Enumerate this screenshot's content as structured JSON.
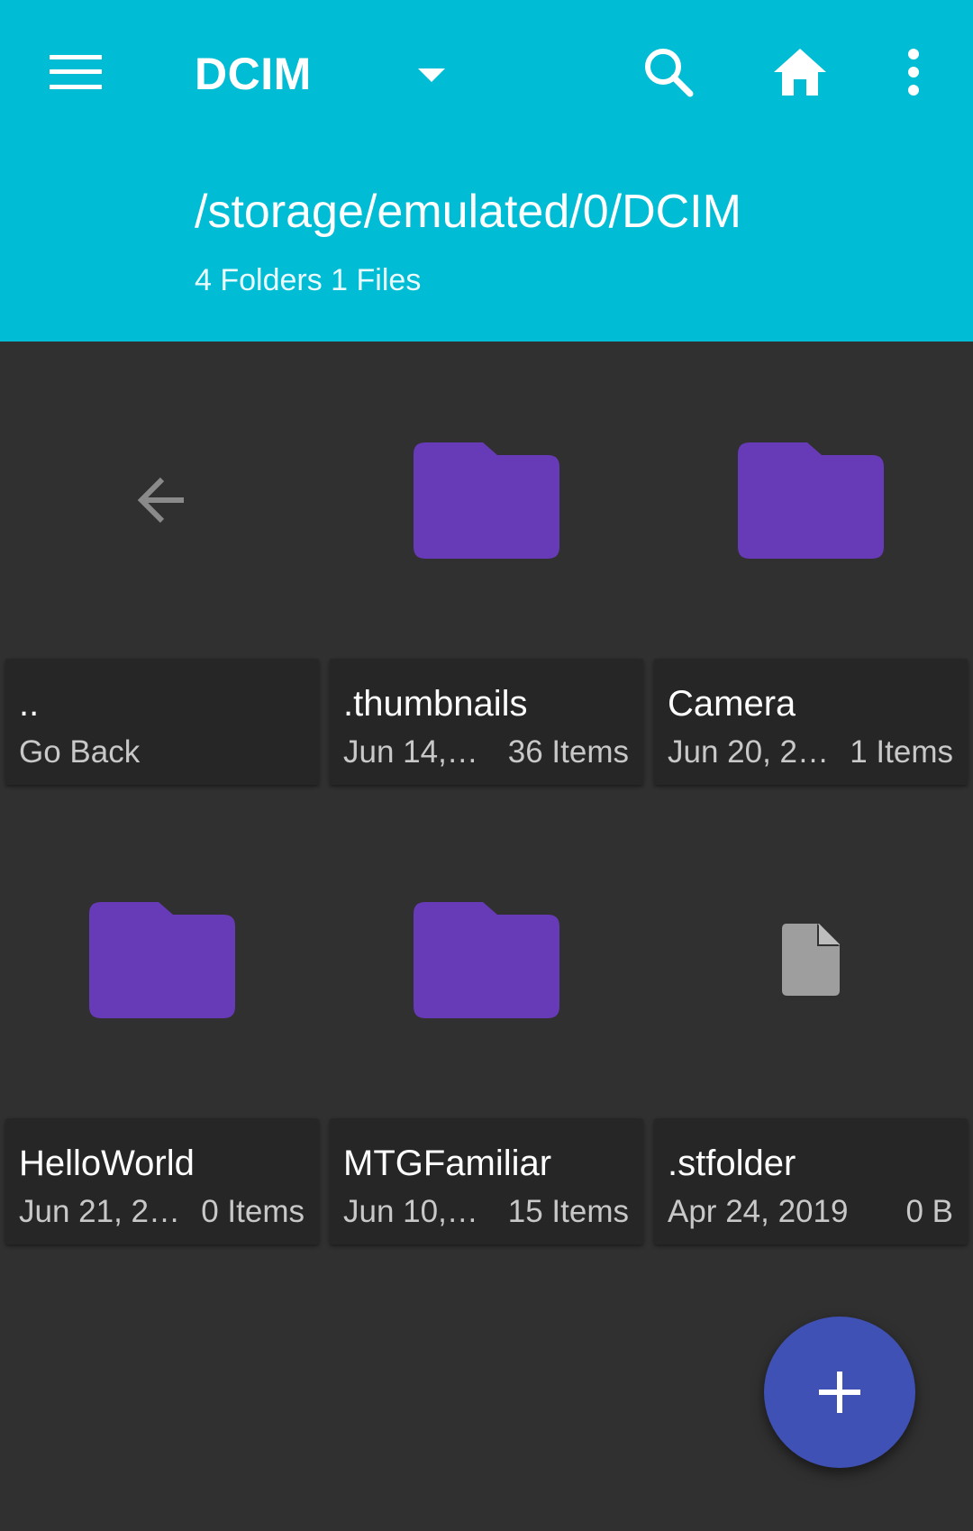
{
  "header": {
    "title": "DCIM",
    "path": "/storage/emulated/0/DCIM",
    "counts": "4 Folders 1 Files",
    "background_color": "#00BCD4",
    "icons": {
      "menu": "menu-icon",
      "title_dropdown": "caret-down-icon",
      "search": "search-icon",
      "home": "home-icon",
      "more": "more-vert-icon"
    }
  },
  "grid": {
    "items": [
      {
        "name": "..",
        "date": "Go Back",
        "size": "",
        "icon": "arrow-back-icon"
      },
      {
        "name": ".thumbnails",
        "date": "Jun 14,…",
        "size": "36 Items",
        "icon": "folder-icon"
      },
      {
        "name": "Camera",
        "date": "Jun 20, 2…",
        "size": "1 Items",
        "icon": "folder-icon"
      },
      {
        "name": "HelloWorld",
        "date": "Jun 21, 2…",
        "size": "0 Items",
        "icon": "folder-icon"
      },
      {
        "name": "MTGFamiliar",
        "date": "Jun 10,…",
        "size": "15 Items",
        "icon": "folder-icon"
      },
      {
        "name": ".stfolder",
        "date": "Apr 24, 2019",
        "size": "0 B",
        "icon": "file-icon"
      }
    ],
    "folder_color": "#673AB7",
    "file_icon_color": "#9E9E9E",
    "back_icon_color": "#8A8A8A"
  },
  "fab": {
    "icon": "add-icon",
    "color": "#3F51B5"
  }
}
